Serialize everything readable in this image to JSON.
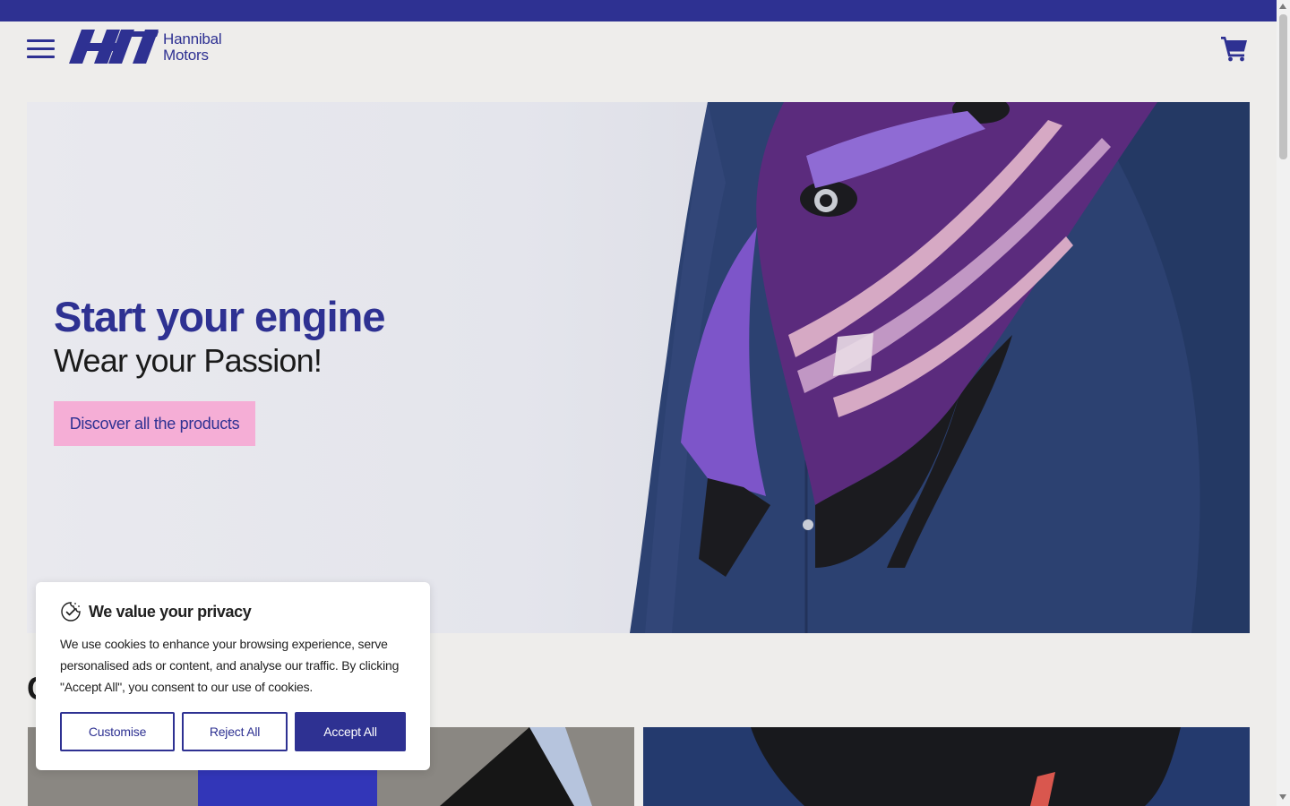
{
  "brand": {
    "name_line1": "Hannibal",
    "name_line2": "Motors",
    "color": "#2e3192",
    "accent_pink": "#f5aed6"
  },
  "header": {
    "menu_icon": "hamburger-menu-icon",
    "cart_icon": "shopping-cart-icon"
  },
  "hero": {
    "title": "Start your engine",
    "subtitle": "Wear your Passion!",
    "cta_label": "Discover all the products"
  },
  "section": {
    "title_partial": "C"
  },
  "cookie_banner": {
    "icon": "cookie-check-icon",
    "title": "We value your privacy",
    "text": "We use cookies to enhance your browsing experience, serve personalised ads or content, and analyse our traffic. By clicking \"Accept All\", you consent to our use of cookies.",
    "customise_label": "Customise",
    "reject_label": "Reject All",
    "accept_label": "Accept All"
  }
}
